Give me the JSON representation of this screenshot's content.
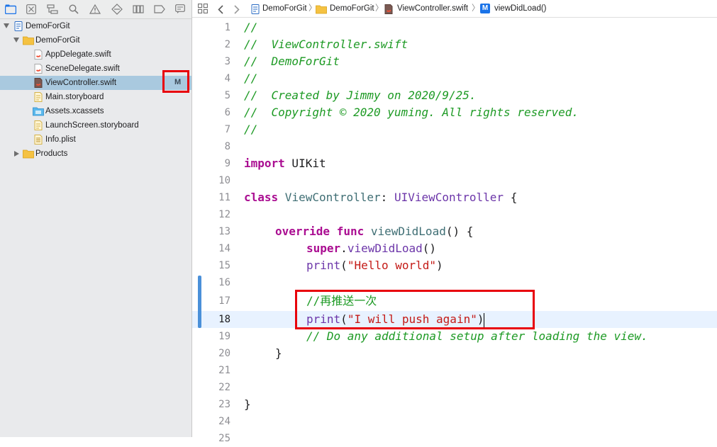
{
  "navigator": {
    "toolbar_icons": [
      "folder-icon",
      "source-control-icon",
      "hierarchy-icon",
      "find-icon",
      "issue-icon",
      "test-icon",
      "debug-icon",
      "breakpoint-icon",
      "report-icon"
    ],
    "tree": [
      {
        "label": "DemoForGit",
        "icon": "project-icon",
        "level": 0,
        "disclosure": "open"
      },
      {
        "label": "DemoForGit",
        "icon": "folder-icon",
        "level": 1,
        "disclosure": "open"
      },
      {
        "label": "AppDelegate.swift",
        "icon": "swift-file-icon",
        "level": 2
      },
      {
        "label": "SceneDelegate.swift",
        "icon": "swift-file-icon",
        "level": 2
      },
      {
        "label": "ViewController.swift",
        "icon": "swift-file-icon",
        "level": 2,
        "selected": true,
        "status": "M"
      },
      {
        "label": "Main.storyboard",
        "icon": "storyboard-icon",
        "level": 2
      },
      {
        "label": "Assets.xcassets",
        "icon": "assets-icon",
        "level": 2
      },
      {
        "label": "LaunchScreen.storyboard",
        "icon": "storyboard-icon",
        "level": 2
      },
      {
        "label": "Info.plist",
        "icon": "plist-icon",
        "level": 2
      },
      {
        "label": "Products",
        "icon": "folder-icon",
        "level": 1,
        "disclosure": "closed"
      }
    ],
    "status_badge": "M"
  },
  "jumpbar": {
    "crumbs": [
      "DemoForGit",
      "DemoForGit",
      "ViewController.swift",
      "viewDidLoad()"
    ],
    "method_badge": "M"
  },
  "editor": {
    "current_line": 18,
    "line_numbers": [
      "1",
      "2",
      "3",
      "4",
      "5",
      "6",
      "7",
      "8",
      "9",
      "10",
      "11",
      "12",
      "13",
      "14",
      "15",
      "16",
      "17",
      "18",
      "19",
      "20",
      "21",
      "22",
      "23",
      "24",
      "25"
    ],
    "lines": {
      "l1": "//",
      "l2": "//  ViewController.swift",
      "l3": "//  DemoForGit",
      "l4": "//",
      "l5": "//  Created by Jimmy on 2020/9/25.",
      "l6": "//  Copyright © 2020 yuming. All rights reserved.",
      "l7": "//",
      "l9_kw": "import",
      "l9_rest": " UIKit",
      "l11_kw": "class",
      "l11_name": " ViewController",
      "l11_colon": ": ",
      "l11_super": "UIViewController",
      "l11_brace": " {",
      "l13_kw1": "override",
      "l13_kw2": " func",
      "l13_name": " viewDidLoad",
      "l13_rest": "() {",
      "l14_kw": "super",
      "l14_dot": ".",
      "l14_fn": "viewDidLoad",
      "l14_rest": "()",
      "l15_fn": "print",
      "l15_open": "(",
      "l15_str": "\"Hello world\"",
      "l15_close": ")",
      "l17": "//再推送一次",
      "l18_fn": "print",
      "l18_open": "(",
      "l18_str": "\"I will push again\"",
      "l18_close": ")",
      "l19": "// Do any additional setup after loading the view.",
      "l20": "}",
      "l23": "}"
    }
  },
  "colors": {
    "comment": "#1d9a24",
    "keyword": "#aa0d91",
    "type": "#3f6e74",
    "string": "#c41a16",
    "highlight_box": "#e8000b",
    "selection": "#a9c9df"
  }
}
